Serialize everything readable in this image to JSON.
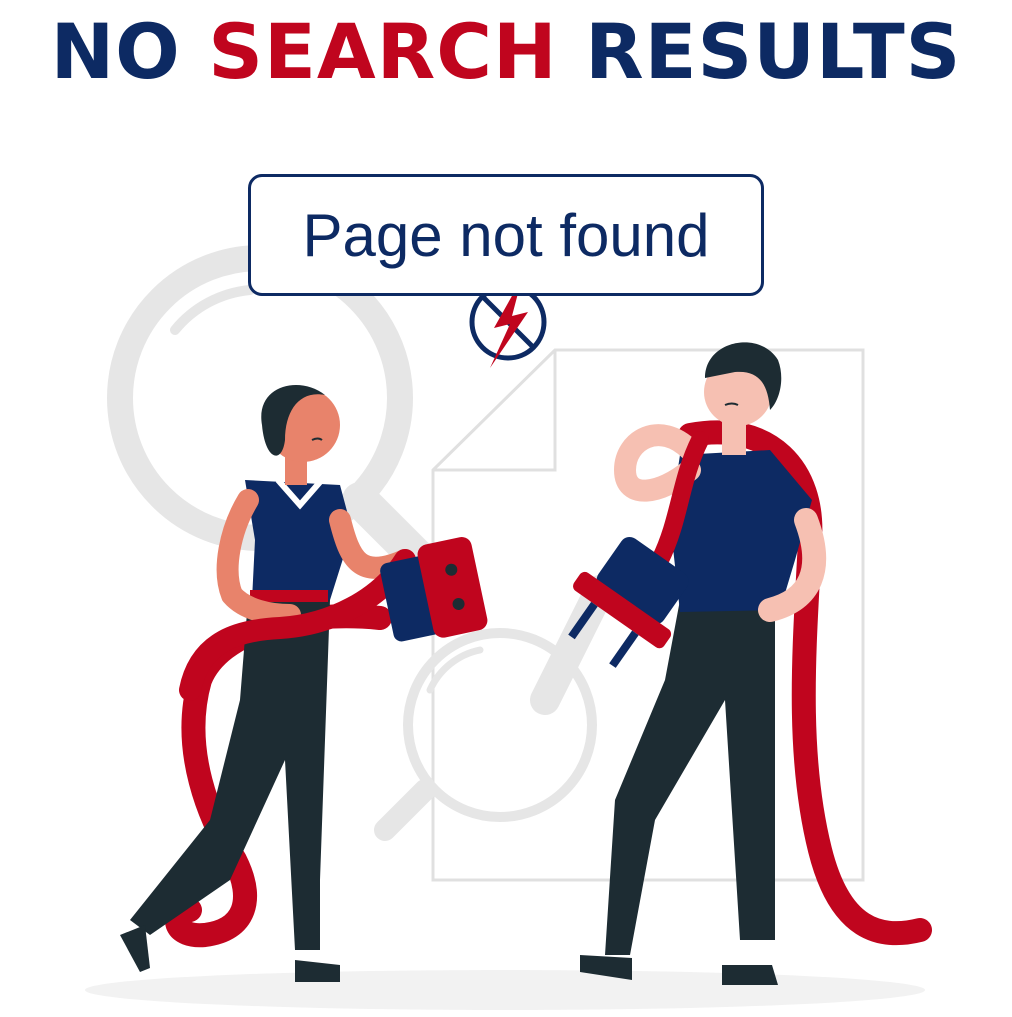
{
  "headline": {
    "word1": "NO",
    "word2": "SEARCH",
    "word3": "RESULTS"
  },
  "callout": {
    "text": "Page not found"
  },
  "colors": {
    "navy": "#0d2a63",
    "red": "#c0051e",
    "dark": "#1d2c33",
    "skin": "#e8836b",
    "grey": "#e6e6e6"
  },
  "icons": [
    "magnifier-icon",
    "document-icon",
    "no-power-icon",
    "plug-icon",
    "socket-icon"
  ]
}
